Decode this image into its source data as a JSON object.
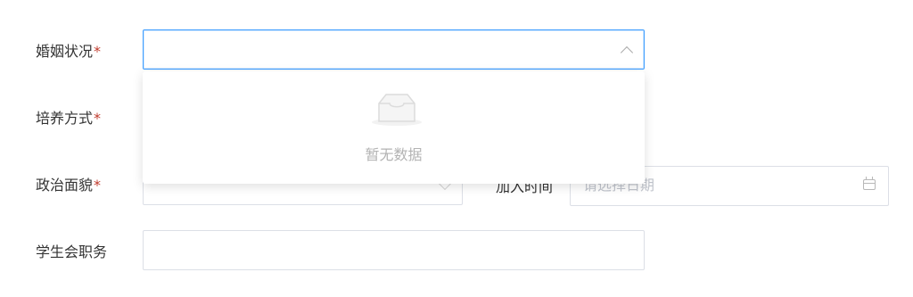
{
  "form": {
    "marital_status": {
      "label": "婚姻状况",
      "required": "*"
    },
    "training_mode": {
      "label": "培养方式",
      "required": "*"
    },
    "political_status": {
      "label": "政治面貌",
      "required": "*"
    },
    "join_date": {
      "label": "加入时间",
      "placeholder": "请选择日期"
    },
    "student_union_position": {
      "label": "学生会职务"
    }
  },
  "dropdown": {
    "empty_text": "暂无数据"
  },
  "icons": {
    "select_open": "chevron-up-icon",
    "select_closed": "chevron-down-icon",
    "date": "calendar-icon",
    "empty": "inbox-empty-icon"
  },
  "colors": {
    "focus_border": "#409eff",
    "required": "#c0392b",
    "placeholder": "#c0c4cc"
  }
}
